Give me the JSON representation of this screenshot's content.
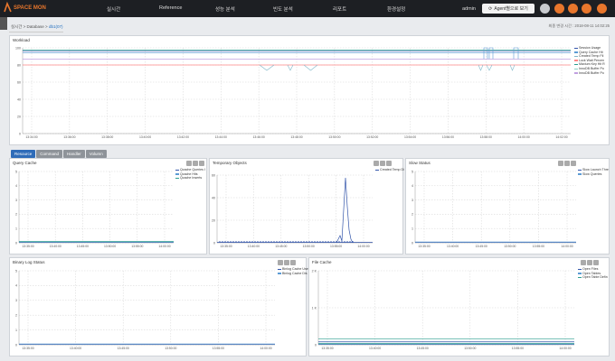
{
  "header": {
    "logo_text": "SPACE MON",
    "menu": [
      "실시간",
      "Reference",
      "성능 분석",
      "빈도 분석",
      "리포트",
      "환경설정"
    ],
    "user": "admin",
    "agent_button": "Agent별으로 보기"
  },
  "breadcrumb": {
    "prefix": "실시간 > Database >",
    "current": "db1(07)"
  },
  "last_updated": "최종 변경 시간 : 2018-08-11 14:02:25",
  "workload": {
    "title": "Workload",
    "legend": [
      "Session Usage",
      "Query Cache Hit",
      "Created Temp Fil",
      "Lock Wait Percen",
      "Maxium Key Hit R",
      "InnoDB Buffer Po",
      "InnoDB Buffer Po"
    ],
    "colors": [
      "#3355aa",
      "#5b9bd5",
      "#7fb6c8",
      "#ff8888",
      "#2a9d8f",
      "#8dd0c4",
      "#c0a0e0"
    ],
    "y_ticks": [
      "100",
      "80",
      "60",
      "40",
      "20",
      "0"
    ],
    "x_ticks": [
      "13:34:00",
      "13:36:00",
      "13:38:00",
      "13:40:00",
      "13:42:00",
      "13:44:00",
      "13:46:00",
      "13:48:00",
      "13:50:00",
      "13:52:00",
      "13:54:00",
      "13:56:00",
      "13:58:00",
      "14:00:00",
      "14:02:00"
    ]
  },
  "tabs": [
    "Resource",
    "Command",
    "Handler",
    "Volumn"
  ],
  "query_cache": {
    "title": "Query Cache",
    "legend": [
      "Qcache Queries I",
      "Qcache Hits",
      "Qcache Inserts"
    ],
    "colors": [
      "#3355aa",
      "#5b9bd5",
      "#2a9d8f"
    ],
    "y_ticks": [
      "5",
      "4",
      "3",
      "2",
      "1",
      "0"
    ],
    "x_ticks": [
      "13:35:00",
      "13:40:00",
      "13:45:00",
      "13:50:00",
      "13:55:00",
      "14:00:00"
    ]
  },
  "temporary_objects": {
    "title": "Temporary Objects",
    "legend": [
      "Created Temp Di"
    ],
    "colors": [
      "#3355aa"
    ],
    "y_ticks": [
      "60",
      "40",
      "20",
      "0"
    ],
    "x_ticks": [
      "13:35:00",
      "13:40:00",
      "13:45:00",
      "13:50:00",
      "13:55:00",
      "14:00:00"
    ]
  },
  "slow_status": {
    "title": "Slow Status",
    "legend": [
      "Slow Launch Thre",
      "Slow Queries"
    ],
    "colors": [
      "#3355aa",
      "#5b9bd5"
    ],
    "y_ticks": [
      "5",
      "4",
      "3",
      "2",
      "1",
      "0"
    ],
    "x_ticks": [
      "13:35:00",
      "13:40:00",
      "13:45:00",
      "13:50:00",
      "13:55:00",
      "14:00:00"
    ]
  },
  "binary_log_status": {
    "title": "Binary Log Status",
    "legend": [
      "Binlog Cache Use",
      "Binlog Cache Dis"
    ],
    "colors": [
      "#3355aa",
      "#5b9bd5"
    ],
    "y_ticks": [
      "5",
      "4",
      "3",
      "2",
      "1",
      "0"
    ],
    "x_ticks": [
      "13:35:00",
      "13:40:00",
      "13:45:00",
      "13:50:00",
      "13:55:00",
      "14:00:00"
    ]
  },
  "file_cache": {
    "title": "File Cache",
    "legend": [
      "Open Files",
      "Open Tables",
      "Open Table Defin"
    ],
    "colors": [
      "#3355aa",
      "#5b9bd5",
      "#2a9d8f"
    ],
    "y_ticks": [
      "2 K",
      "1 K",
      "0"
    ],
    "x_ticks": [
      "13:35:00",
      "13:40:00",
      "13:45:00",
      "13:50:00",
      "13:55:00",
      "14:00:00"
    ]
  }
}
